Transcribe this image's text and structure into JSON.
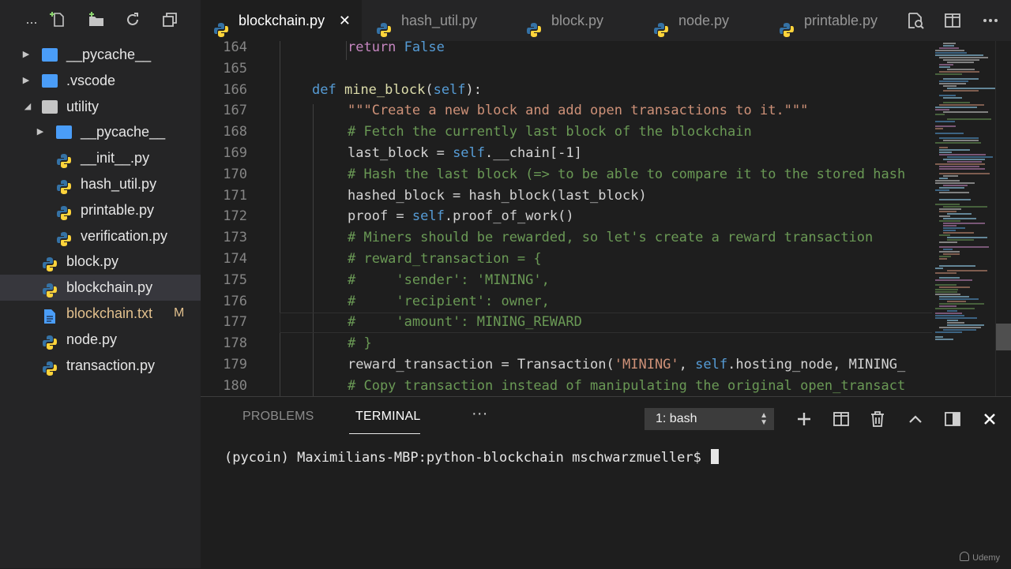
{
  "sidebar": {
    "more_label": "...",
    "items": [
      {
        "label": "__pycache__",
        "kind": "folder-blue",
        "level": 0,
        "expanded": false
      },
      {
        "label": ".vscode",
        "kind": "folder-vscode",
        "level": 0,
        "expanded": false
      },
      {
        "label": "utility",
        "kind": "folder-open",
        "level": 0,
        "expanded": true
      },
      {
        "label": "__pycache__",
        "kind": "folder-blue",
        "level": 1,
        "expanded": false
      },
      {
        "label": "__init__.py",
        "kind": "python",
        "level": 1
      },
      {
        "label": "hash_util.py",
        "kind": "python",
        "level": 1
      },
      {
        "label": "printable.py",
        "kind": "python",
        "level": 1
      },
      {
        "label": "verification.py",
        "kind": "python",
        "level": 1
      },
      {
        "label": "block.py",
        "kind": "python",
        "level": 0
      },
      {
        "label": "blockchain.py",
        "kind": "python",
        "level": 0,
        "selected": true
      },
      {
        "label": "blockchain.txt",
        "kind": "text",
        "level": 0,
        "modified": true,
        "badge": "M"
      },
      {
        "label": "node.py",
        "kind": "python",
        "level": 0
      },
      {
        "label": "transaction.py",
        "kind": "python",
        "level": 0
      }
    ]
  },
  "tabs": [
    {
      "label": "blockchain.py",
      "active": true,
      "close": "✕"
    },
    {
      "label": "hash_util.py"
    },
    {
      "label": "block.py"
    },
    {
      "label": "node.py"
    },
    {
      "label": "printable.py"
    }
  ],
  "editor": {
    "lines": [
      {
        "num": "164",
        "tokens": [
          [
            "ctl",
            "return"
          ],
          [
            "plain",
            " "
          ],
          [
            "kw",
            "False"
          ]
        ]
      },
      {
        "num": "165",
        "tokens": []
      },
      {
        "num": "166",
        "tokens": [
          [
            "kw",
            "def"
          ],
          [
            "plain",
            " "
          ],
          [
            "fn",
            "mine_block"
          ],
          [
            "plain",
            "("
          ],
          [
            "slf",
            "self"
          ],
          [
            "plain",
            "):"
          ]
        ]
      },
      {
        "num": "167",
        "tokens": [
          [
            "str",
            "\"\"\"Create a new block and add open transactions to it.\"\"\""
          ]
        ]
      },
      {
        "num": "168",
        "tokens": [
          [
            "cmt",
            "# Fetch the currently last block of the blockchain"
          ]
        ]
      },
      {
        "num": "169",
        "tokens": [
          [
            "plain",
            "last_block = "
          ],
          [
            "slf",
            "self"
          ],
          [
            "plain",
            ".__chain[-1]"
          ]
        ]
      },
      {
        "num": "170",
        "tokens": [
          [
            "cmt",
            "# Hash the last block (=> to be able to compare it to the stored hash"
          ]
        ]
      },
      {
        "num": "171",
        "tokens": [
          [
            "plain",
            "hashed_block = hash_block(last_block)"
          ]
        ]
      },
      {
        "num": "172",
        "tokens": [
          [
            "plain",
            "proof = "
          ],
          [
            "slf",
            "self"
          ],
          [
            "plain",
            ".proof_of_work()"
          ]
        ]
      },
      {
        "num": "173",
        "tokens": [
          [
            "cmt",
            "# Miners should be rewarded, so let's create a reward transaction"
          ]
        ]
      },
      {
        "num": "174",
        "tokens": [
          [
            "cmt",
            "# reward_transaction = {"
          ]
        ]
      },
      {
        "num": "175",
        "tokens": [
          [
            "cmt",
            "#     'sender': 'MINING',"
          ]
        ]
      },
      {
        "num": "176",
        "tokens": [
          [
            "cmt",
            "#     'recipient': owner,"
          ]
        ]
      },
      {
        "num": "177",
        "tokens": [
          [
            "cmt",
            "#     'amount': MINING_REWARD"
          ]
        ]
      },
      {
        "num": "178",
        "tokens": [
          [
            "cmt",
            "# }"
          ]
        ]
      },
      {
        "num": "179",
        "tokens": [
          [
            "plain",
            "reward_transaction = Transaction("
          ],
          [
            "str",
            "'MINING'"
          ],
          [
            "plain",
            ", "
          ],
          [
            "slf",
            "self"
          ],
          [
            "plain",
            ".hosting_node, MINING_"
          ]
        ]
      },
      {
        "num": "180",
        "tokens": [
          [
            "cmt",
            "# Copy transaction instead of manipulating the original open_transact"
          ]
        ]
      }
    ]
  },
  "panel": {
    "tabs": [
      {
        "label": "PROBLEMS"
      },
      {
        "label": "TERMINAL",
        "active": true
      },
      {
        "label": "···"
      }
    ],
    "shell": "1: bash",
    "terminal_prompt": "(pycoin) Maximilians-MBP:python-blockchain mschwarzmueller$ "
  },
  "watermark": "Udemy",
  "colors": {
    "background": "#1e1e1e",
    "sidebar": "#252526",
    "python_blue": "#3572a5",
    "python_yellow": "#ffd43b",
    "folder_blue": "#4a9df8",
    "modified": "#e2c08d",
    "comment": "#6a9955",
    "string": "#ce9178",
    "keyword": "#569cd6",
    "control": "#c586c0",
    "function": "#dcdcaa"
  }
}
